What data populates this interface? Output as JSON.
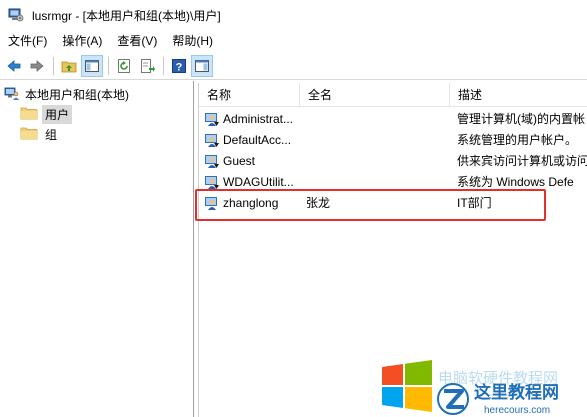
{
  "window": {
    "title": "lusrmgr - [本地用户和组(本地)\\用户]"
  },
  "menu": [
    {
      "label": "文件(F)"
    },
    {
      "label": "操作(A)"
    },
    {
      "label": "查看(V)"
    },
    {
      "label": "帮助(H)"
    }
  ],
  "toolbar": {
    "buttons": [
      {
        "icon": "back-arrow-icon"
      },
      {
        "icon": "forward-arrow-icon"
      },
      {
        "icon": "up-folder-icon"
      },
      {
        "icon": "show-hide-tree-icon"
      },
      {
        "icon": "refresh-icon"
      },
      {
        "icon": "export-list-icon"
      },
      {
        "icon": "help-icon"
      },
      {
        "icon": "show-hide-action-pane-icon"
      }
    ]
  },
  "tree": {
    "root": "本地用户和组(本地)",
    "children": [
      {
        "label": "用户",
        "selected": true
      },
      {
        "label": "组",
        "selected": false
      }
    ]
  },
  "list": {
    "columns": [
      "名称",
      "全名",
      "描述"
    ],
    "rows": [
      {
        "name": "Administrat...",
        "fullname": "",
        "description": "管理计算机(域)的内置帐"
      },
      {
        "name": "DefaultAcc...",
        "fullname": "",
        "description": "系统管理的用户帐户。"
      },
      {
        "name": "Guest",
        "fullname": "",
        "description": "供来宾访问计算机或访问"
      },
      {
        "name": "WDAGUtilit...",
        "fullname": "",
        "description": "系统为 Windows Defe"
      },
      {
        "name": "zhanglong",
        "fullname": "张龙",
        "description": "IT部门"
      }
    ]
  },
  "watermark": {
    "cn": "这里教程网",
    "en": "herecours.com",
    "faint": "电脑软硬件教程网"
  },
  "colors": {
    "highlight_border": "#e0302c",
    "selected_bg": "#d9d9d9",
    "toolbar_pressed": "#cce4f7"
  }
}
